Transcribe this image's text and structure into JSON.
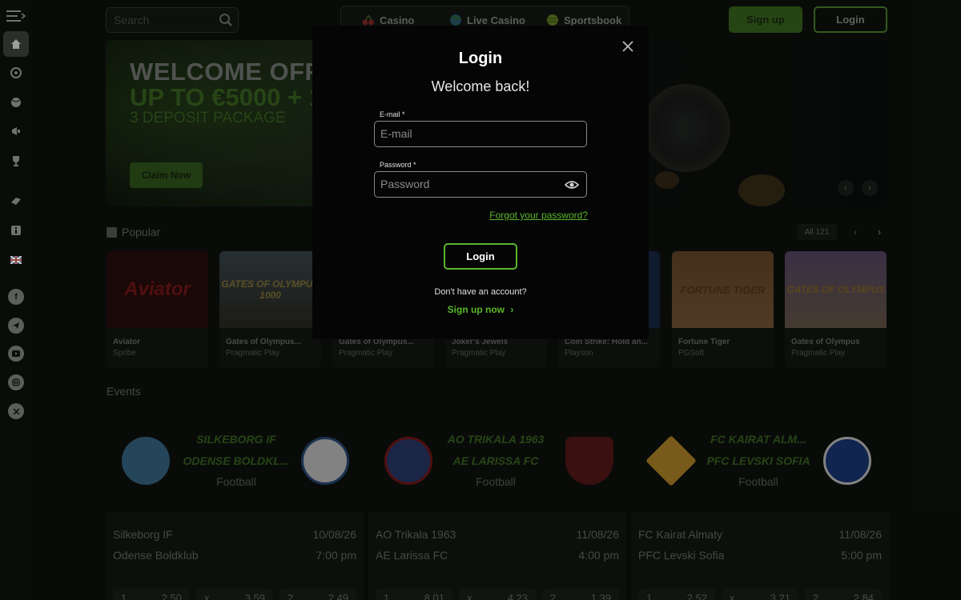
{
  "search": {
    "placeholder": "Search"
  },
  "nav": {
    "casino": "Casino",
    "live_casino": "Live Casino",
    "sportsbook": "Sportsbook"
  },
  "auth": {
    "signup": "Sign up",
    "login": "Login"
  },
  "banner": {
    "line1": "WELCOME OFFE",
    "line2": "UP TO €5000 + 15",
    "line3": "3 DEPOSIT PACKAGE",
    "cta": "Claim Now"
  },
  "popular": {
    "title": "Popular",
    "all_label": "All",
    "all_count": "121",
    "games": [
      {
        "title": "Aviator",
        "provider": "Spribe",
        "art": "Aviator"
      },
      {
        "title": "Gates of Olympus...",
        "provider": "Pragmatic Play",
        "art": "GATES OF OLYMPUS 1000"
      },
      {
        "title": "Gates of Olympus...",
        "provider": "Pragmatic Play",
        "art": ""
      },
      {
        "title": "Joker's Jewels",
        "provider": "Pragmatic Play",
        "art": ""
      },
      {
        "title": "Coin Strike: Hold an...",
        "provider": "Playson",
        "art": ""
      },
      {
        "title": "Fortune Tiger",
        "provider": "PGSoft",
        "art": "FORTUNE TIGER"
      },
      {
        "title": "Gates of Olympus",
        "provider": "Pragmatic Play",
        "art": "GATES OF OLYMPUS"
      }
    ]
  },
  "events": {
    "title": "Events",
    "cards": [
      {
        "home": "SILKEBORG IF",
        "away": "ODENSE BOLDKL...",
        "sport": "Football",
        "home_full": "Silkeborg IF",
        "away_full": "Odense Boldklub",
        "date": "10/08/26",
        "time": "7:00 pm",
        "odds": [
          [
            "1",
            "2.50"
          ],
          [
            "x",
            "3.59"
          ],
          [
            "2",
            "2.49"
          ]
        ]
      },
      {
        "home": "AO TRIKALA 1963",
        "away": "AE LARISSA FC",
        "sport": "Football",
        "home_full": "AO Trikala 1963",
        "away_full": "AE Larissa FC",
        "date": "11/08/26",
        "time": "4:00 pm",
        "odds": [
          [
            "1",
            "8.01"
          ],
          [
            "x",
            "4.23"
          ],
          [
            "2",
            "1.39"
          ]
        ]
      },
      {
        "home": "FC KAIRAT ALM...",
        "away": "PFC LEVSKI SOFIA",
        "sport": "Football",
        "home_full": "FC Kairat Almaty",
        "away_full": "PFC Levski Sofia",
        "date": "11/08/26",
        "time": "5:00 pm",
        "odds": [
          [
            "1",
            "2.52"
          ],
          [
            "x",
            "3.21"
          ],
          [
            "2",
            "2.84"
          ]
        ]
      }
    ]
  },
  "modal": {
    "title": "Login",
    "subtitle": "Welcome back!",
    "email_label": "E-mail *",
    "email_placeholder": "E-mail",
    "password_label": "Password *",
    "password_placeholder": "Password",
    "forgot": "Forgot your password?",
    "submit": "Login",
    "no_account": "Don't have an account?",
    "signup_link": "Sign up now"
  },
  "colors": {
    "accent": "#5ab72b",
    "background": "#0f120f",
    "modal_bg": "#050505"
  },
  "icons": [
    "menu-icon",
    "home-icon",
    "casino-chip-icon",
    "sports-ball-icon",
    "megaphone-icon",
    "trophy-icon",
    "sportsbook-icon",
    "info-icon",
    "uk-flag-icon",
    "facebook-icon",
    "telegram-icon",
    "youtube-icon",
    "instagram-icon",
    "x-icon"
  ]
}
